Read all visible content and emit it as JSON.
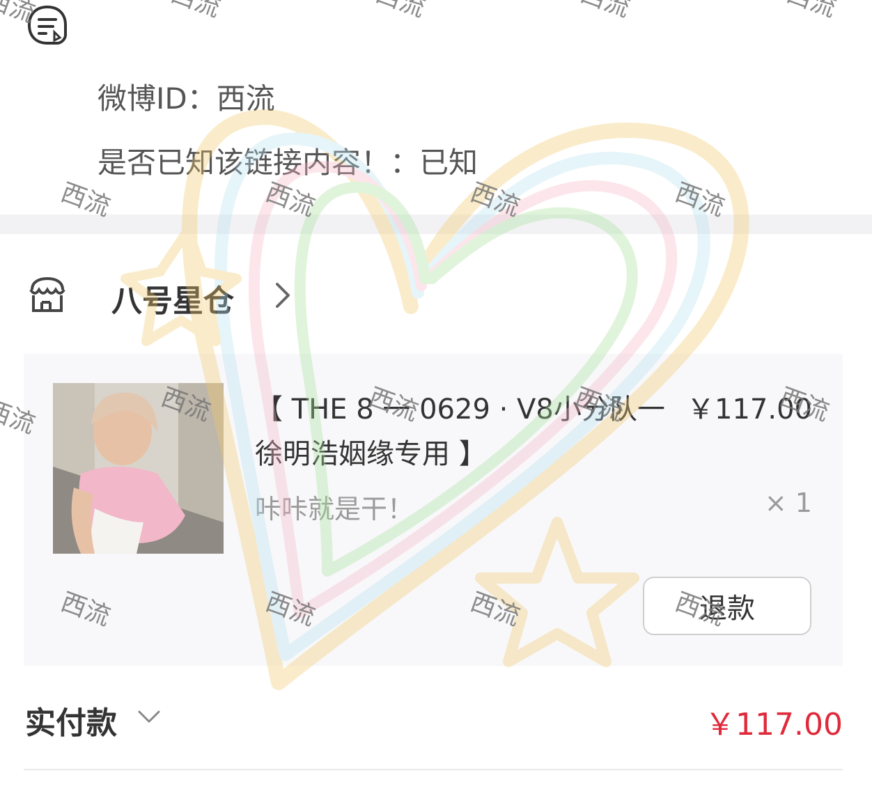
{
  "info": {
    "weibo_line": "微博ID：西流",
    "known_line": "是否已知该链接内容！：已知",
    "note_icon": "note-icon"
  },
  "shop": {
    "name": "八号星仓",
    "icon": "store-icon",
    "chevron": "chevron-right-icon"
  },
  "product": {
    "title": "【 THE 8 一 0629 · V8小分队一 徐明浩姻缘专用 】",
    "price": "￥117.00",
    "spec": "咔咔就是干！",
    "quantity": "× 1",
    "refund_label": "退款",
    "thumbnail": "product-photo"
  },
  "payment": {
    "label": "实付款",
    "amount": "￥117.00",
    "amount_color": "#e0293a"
  },
  "watermark": {
    "text": "西流"
  }
}
